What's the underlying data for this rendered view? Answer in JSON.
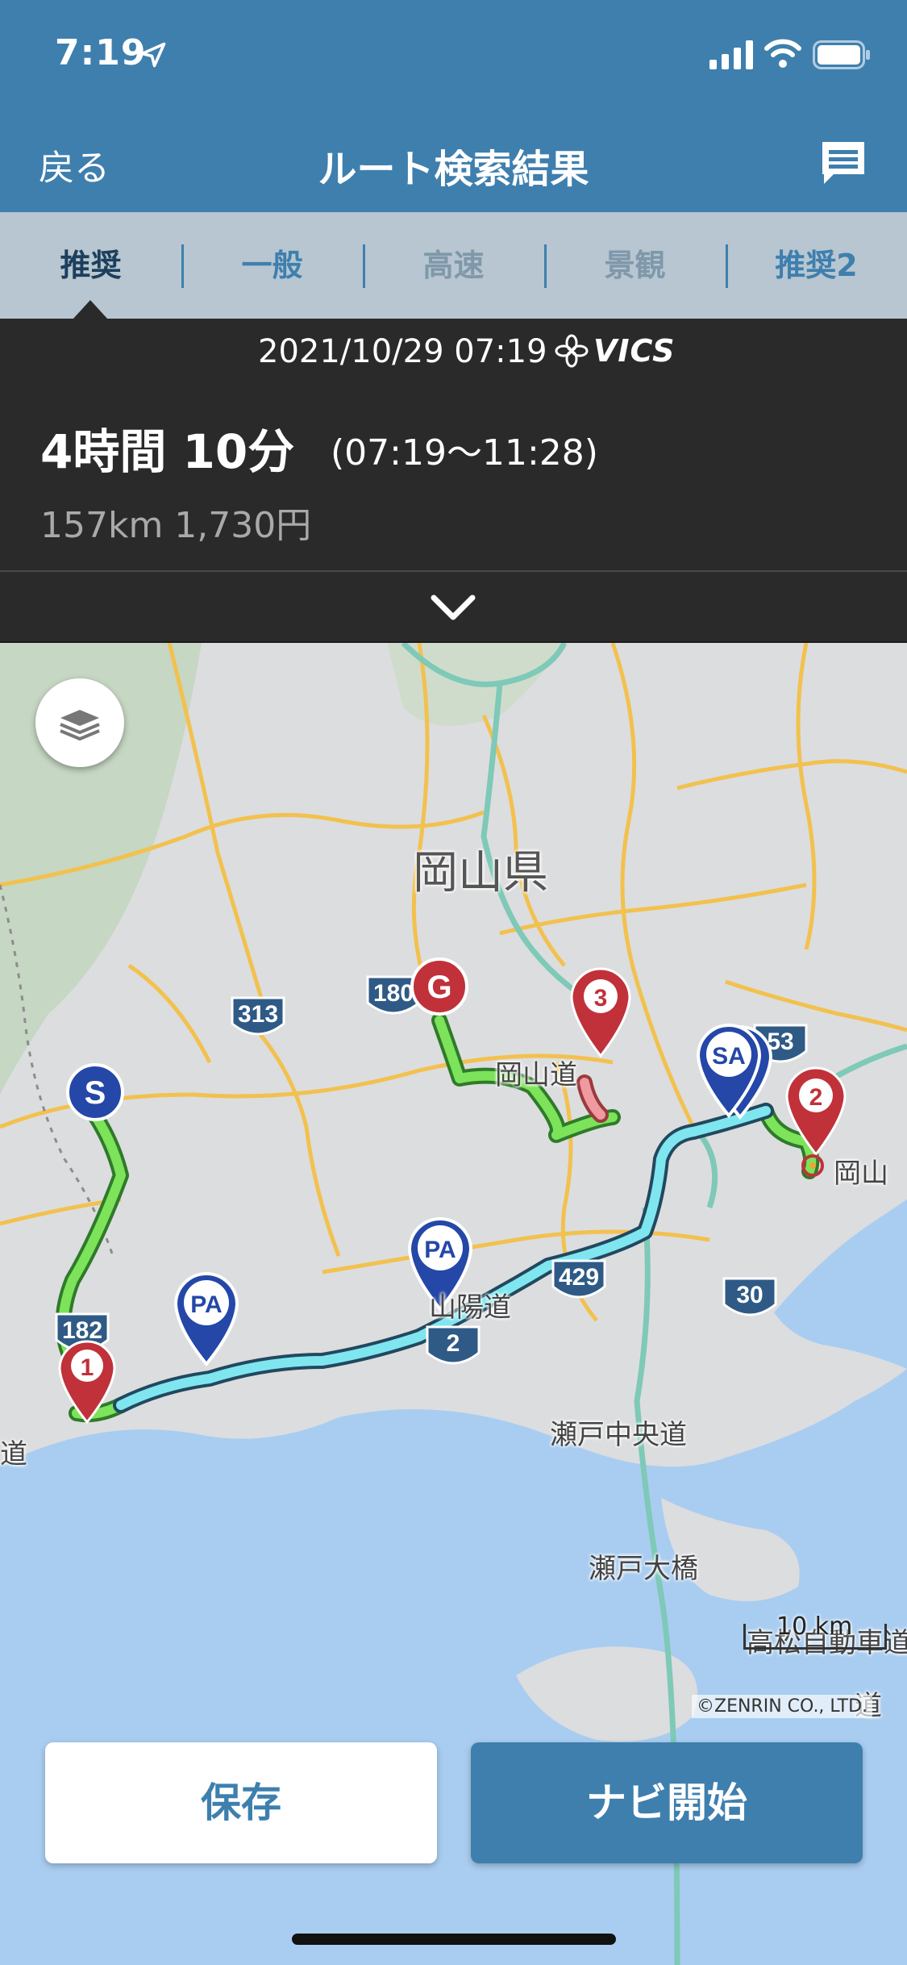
{
  "status_bar": {
    "time": "7:19"
  },
  "nav": {
    "back_label": "戻る",
    "title": "ルート検索結果"
  },
  "tabs": [
    {
      "label": "推奨",
      "state": "active"
    },
    {
      "label": "一般",
      "state": "normal"
    },
    {
      "label": "高速",
      "state": "disabled"
    },
    {
      "label": "景観",
      "state": "disabled"
    },
    {
      "label": "推奨2",
      "state": "normal"
    }
  ],
  "summary": {
    "datetime": "2021/10/29 07:19",
    "provider": "VICS",
    "duration": "4時間 10分",
    "time_span": "(07:19～11:28)",
    "distance_toll": "157km  1,730円"
  },
  "map": {
    "labels": {
      "prefecture": "岡山県",
      "okayama_road": "岡山道",
      "okayama_city": "岡山",
      "sanyo_road": "山陽道",
      "seto_chuo": "瀬戸中央道",
      "seto_ohashi": "瀬戸大橋",
      "takamatsu": "高松自動車道",
      "left_edge_road": "道",
      "right_edge_road": "道"
    },
    "route_shields": [
      "313",
      "180",
      "53",
      "182",
      "429",
      "2",
      "30"
    ],
    "markers": {
      "start": "S",
      "goal": "G",
      "waypoint_1": "1",
      "waypoint_2": "2",
      "waypoint_3": "3",
      "parking_area": "PA",
      "service_area": "SA"
    },
    "scale": "10 km",
    "copyright": "©ZENRIN CO., LTD."
  },
  "actions": {
    "save_label": "保存",
    "start_label": "ナビ開始"
  },
  "colors": {
    "header": "#3e7fae",
    "tabs_bg": "#b7c6d0",
    "panel": "#2a2a2a",
    "route_general": "#7ce35a",
    "route_highway": "#7fe6f0",
    "route_congestion": "#ef9aa0",
    "marker_red": "#c0313a",
    "marker_blue": "#2447a8"
  }
}
